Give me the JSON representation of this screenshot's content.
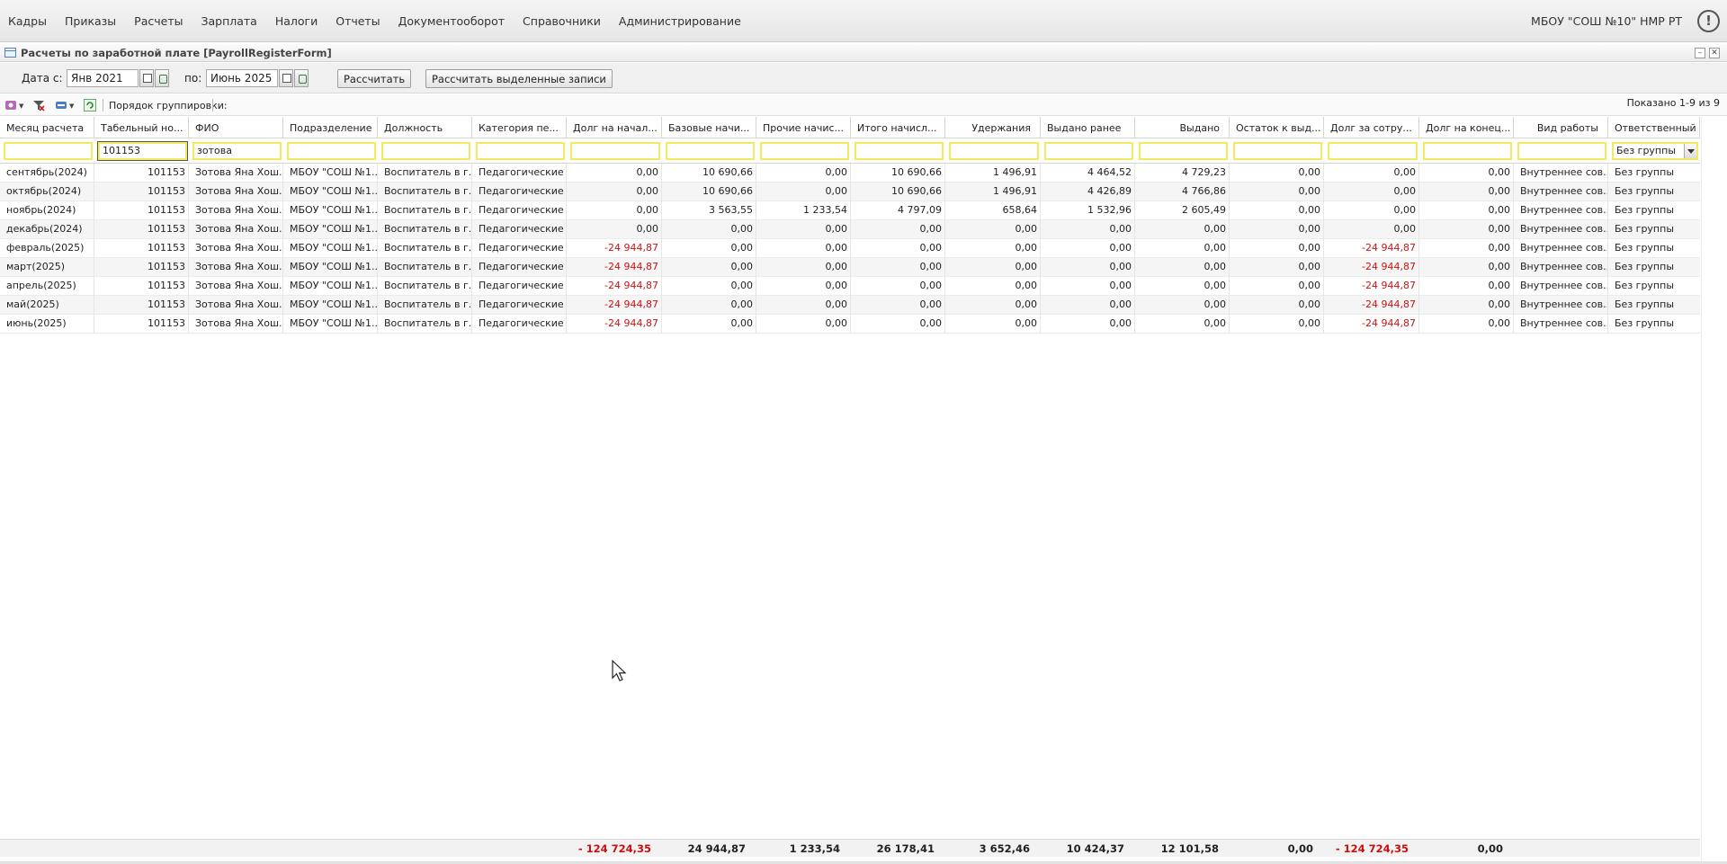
{
  "menu": {
    "items": [
      "Кадры",
      "Приказы",
      "Расчеты",
      "Зарплата",
      "Налоги",
      "Отчеты",
      "Документооборот",
      "Справочники",
      "Администрирование"
    ],
    "organization": "МБОУ \"СОШ №10\" НМР РТ",
    "alert_icon": "!"
  },
  "window": {
    "title": "Расчеты по заработной плате [PayrollRegisterForm]",
    "minimize": "–",
    "close": "✕"
  },
  "params": {
    "date_from_label": "Дата с:",
    "date_from": "Янв 2021",
    "date_to_label": "по:",
    "date_to": "Июнь 2025",
    "calc_button": "Рассчитать",
    "calc_selected_button": "Рассчитать выделенные записи"
  },
  "gridbar": {
    "grouping_label": "Порядок группировки:",
    "shown": "Показано 1-9 из 9"
  },
  "columns": [
    "Месяц расчета",
    "Табельный но...",
    "ФИО",
    "Подразделение",
    "Должность",
    "Категория пе...",
    "Долг на начал...",
    "Базовые начи...",
    "Прочие начис...",
    "Итого начисл...",
    "Удержания",
    "Выдано ранее",
    "Выдано",
    "Остаток к выд...",
    "Долг за сотру...",
    "Долг на конец...",
    "Вид работы",
    "Ответственный ..."
  ],
  "filters": {
    "tab_number": "101153",
    "fio": "зотова",
    "responsible": "Без группы"
  },
  "rows": [
    [
      "сентябрь(2024)",
      "101153",
      "Зотова Яна Хош...",
      "МБОУ \"СОШ №1...",
      "Воспитатель в г...",
      "Педагогические ...",
      "0,00",
      "10 690,66",
      "0,00",
      "10 690,66",
      "1 496,91",
      "4 464,52",
      "4 729,23",
      "0,00",
      "0,00",
      "0,00",
      "Внутреннее сов...",
      "Без группы"
    ],
    [
      "октябрь(2024)",
      "101153",
      "Зотова Яна Хош...",
      "МБОУ \"СОШ №1...",
      "Воспитатель в г...",
      "Педагогические ...",
      "0,00",
      "10 690,66",
      "0,00",
      "10 690,66",
      "1 496,91",
      "4 426,89",
      "4 766,86",
      "0,00",
      "0,00",
      "0,00",
      "Внутреннее сов...",
      "Без группы"
    ],
    [
      "ноябрь(2024)",
      "101153",
      "Зотова Яна Хош...",
      "МБОУ \"СОШ №1...",
      "Воспитатель в г...",
      "Педагогические ...",
      "0,00",
      "3 563,55",
      "1 233,54",
      "4 797,09",
      "658,64",
      "1 532,96",
      "2 605,49",
      "0,00",
      "0,00",
      "0,00",
      "Внутреннее сов...",
      "Без группы"
    ],
    [
      "декабрь(2024)",
      "101153",
      "Зотова Яна Хош...",
      "МБОУ \"СОШ №1...",
      "Воспитатель в г...",
      "Педагогические ...",
      "0,00",
      "0,00",
      "0,00",
      "0,00",
      "0,00",
      "0,00",
      "0,00",
      "0,00",
      "0,00",
      "0,00",
      "Внутреннее сов...",
      "Без группы"
    ],
    [
      "февраль(2025)",
      "101153",
      "Зотова Яна Хош...",
      "МБОУ \"СОШ №1...",
      "Воспитатель в г...",
      "Педагогические ...",
      "-24 944,87",
      "0,00",
      "0,00",
      "0,00",
      "0,00",
      "0,00",
      "0,00",
      "0,00",
      "-24 944,87",
      "0,00",
      "Внутреннее сов...",
      "Без группы"
    ],
    [
      "март(2025)",
      "101153",
      "Зотова Яна Хош...",
      "МБОУ \"СОШ №1...",
      "Воспитатель в г...",
      "Педагогические ...",
      "-24 944,87",
      "0,00",
      "0,00",
      "0,00",
      "0,00",
      "0,00",
      "0,00",
      "0,00",
      "-24 944,87",
      "0,00",
      "Внутреннее сов...",
      "Без группы"
    ],
    [
      "апрель(2025)",
      "101153",
      "Зотова Яна Хош...",
      "МБОУ \"СОШ №1...",
      "Воспитатель в г...",
      "Педагогические ...",
      "-24 944,87",
      "0,00",
      "0,00",
      "0,00",
      "0,00",
      "0,00",
      "0,00",
      "0,00",
      "-24 944,87",
      "0,00",
      "Внутреннее сов...",
      "Без группы"
    ],
    [
      "май(2025)",
      "101153",
      "Зотова Яна Хош...",
      "МБОУ \"СОШ №1...",
      "Воспитатель в г...",
      "Педагогические ...",
      "-24 944,87",
      "0,00",
      "0,00",
      "0,00",
      "0,00",
      "0,00",
      "0,00",
      "0,00",
      "-24 944,87",
      "0,00",
      "Внутреннее сов...",
      "Без группы"
    ],
    [
      "июнь(2025)",
      "101153",
      "Зотова Яна Хош...",
      "МБОУ \"СОШ №1...",
      "Воспитатель в г...",
      "Педагогические ...",
      "-24 944,87",
      "0,00",
      "0,00",
      "0,00",
      "0,00",
      "0,00",
      "0,00",
      "0,00",
      "-24 944,87",
      "0,00",
      "Внутреннее сов...",
      "Без группы"
    ]
  ],
  "totals": {
    "debt_start": "- 124 724,35",
    "base": "24 944,87",
    "other": "1 233,54",
    "total_accrued": "26 178,41",
    "deductions": "3 652,46",
    "paid_before": "10 424,37",
    "paid": "12 101,58",
    "remaining": "0,00",
    "debt_employee": "- 124 724,35",
    "debt_end": "0,00"
  },
  "colors": {
    "negative": "#d01010",
    "filter_border": "#f2ea60"
  }
}
